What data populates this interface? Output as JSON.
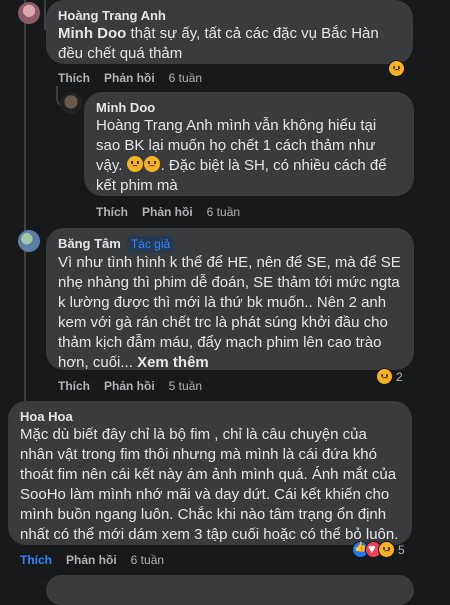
{
  "comments": [
    {
      "author": "Hoàng Trang Anh",
      "mention": "Minh Doo",
      "text": " thật sự ấy, tất cả các đặc vụ Bắc Hàn đều chết quá thảm",
      "like": "Thích",
      "reply": "Phản hồi",
      "time": "6 tuần",
      "reactions": [
        "sad-emoji"
      ]
    },
    {
      "author": "Minh Doo",
      "mention": "Hoàng Trang Anh",
      "text": " mình vẫn không hiểu tại sao BK lại muốn họ chết 1 cách thảm như vậy.",
      "text2": ". Đặc biệt là SH, có nhiều cách để kết phim mà",
      "like": "Thích",
      "reply": "Phản hồi",
      "time": "6 tuần"
    },
    {
      "author": "Băng Tâm",
      "badge": "Tác giả",
      "text": "Vì như tình hình k thể để HE, nên để SE, mà để SE nhẹ nhàng thì phim dễ đoán, SE thảm tới mức ngta k lường được thì mới là thứ bk muốn.. Nên 2 anh kem với gà rán chết trc là phát súng khởi đầu cho thảm kịch đẫm máu, đẩy mạch phim lên cao trào hơn, cuối...",
      "see_more": "Xem thêm",
      "like": "Thích",
      "reply": "Phản hồi",
      "time": "5 tuần",
      "reaction_count": "2"
    },
    {
      "author": "Hoa Hoa",
      "text": "Mặc dù biết đây chỉ là bộ fim , chỉ là câu chuyện của nhân vật trong fim thôi nhưng mà mình là cái đứa khó thoát fim nên cái kết này ám ảnh mình quá. Ánh mắt của SooHo làm mình nhớ mãi và day dứt. Cái kết khiến cho mình buồn ngang luôn. Chắc khi nào tâm trạng ổn định nhất có thể mới dám xem 3 tập cuối hoặc có thể bỏ luôn.",
      "like": "Thích",
      "reply": "Phản hồi",
      "time": "6 tuần",
      "reaction_count": "5"
    }
  ],
  "colors": {
    "background": "#18191a",
    "bubble": "#3a3b3c",
    "text": "#e4e6eb",
    "secondary": "#b0b3b8",
    "accent": "#2d88ff"
  }
}
